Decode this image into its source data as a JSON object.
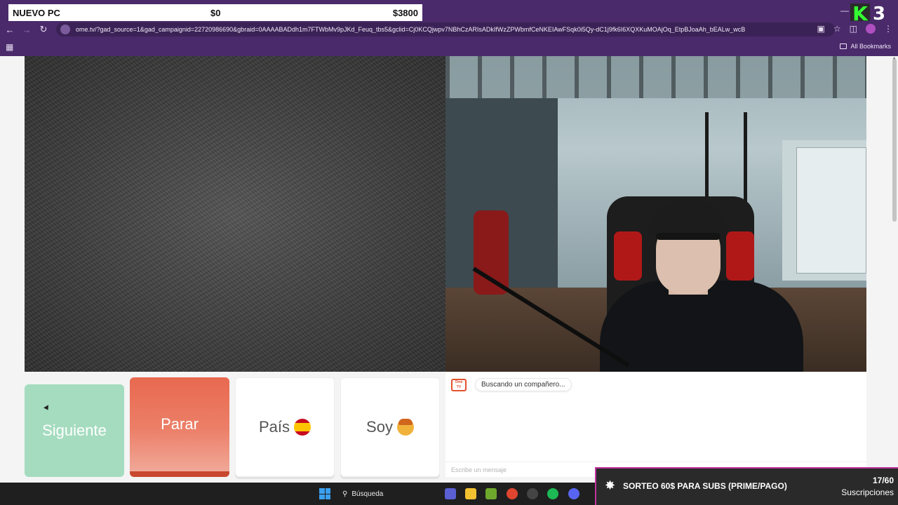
{
  "stream_overlay": {
    "goal_title": "NUEVO PC",
    "goal_current": "$0",
    "goal_target": "$3800",
    "brand_letter": "K",
    "brand_number": "3"
  },
  "browser": {
    "url": "ome.tv/?gad_source=1&gad_campaignid=22720986690&gbraid=0AAAABADdh1m7FTWbMv9pJKd_Feuq_tbs5&gclid=Cj0KCQjwpv7NBhCzARIsADkIfWzZPWbmfCeNKEIAwFSqk0i5Qy-dC1j9fk6I6XQXKuMOAjOq_EtpBJoaAh_bEALw_wcB",
    "all_bookmarks": "All Bookmarks"
  },
  "controls": {
    "next_label": "Siguiente",
    "stop_label": "Parar",
    "country_label": "País",
    "soy_label": "Soy"
  },
  "chat": {
    "logo_text": "Ome TV",
    "status_message": "Buscando un compañero...",
    "input_placeholder": "Escribe un mensaje"
  },
  "sorteo": {
    "text": "SORTEO 60$ PARA SUBS (PRIME/PAGO)",
    "count": "17/60",
    "label": "Suscripciones"
  },
  "taskbar": {
    "search_label": "Búsqueda"
  },
  "colors": {
    "chrome": "#4a2a6b",
    "next_button": "#a5dcbf",
    "stop_button": "#e8694f",
    "sorteo_accent": "#c0349f"
  },
  "icons": [
    "back-icon",
    "forward-icon",
    "reload-icon",
    "apps-icon",
    "star-icon",
    "extensions-icon",
    "menu-icon",
    "spain-flag-icon",
    "person-emoji-icon",
    "windows-start-icon",
    "search-icon",
    "chrome-icon",
    "spotify-icon",
    "discord-icon"
  ]
}
